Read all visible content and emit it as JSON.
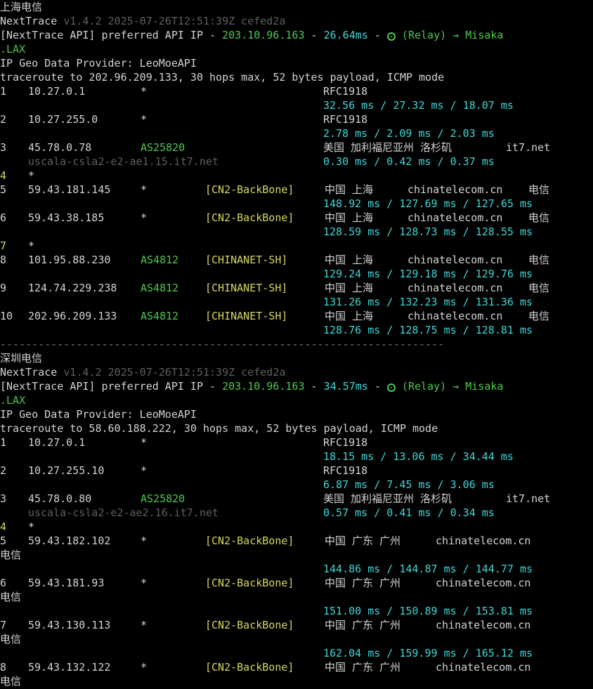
{
  "sections": [
    {
      "heading": "上海电信",
      "nt_name": "NextTrace",
      "nt_version": "v1.4.2 2025-07-26T12:51:39Z cefed2a",
      "api_prefix": "[NextTrace API] preferred API IP - ",
      "api_ip": "203.10.96.163",
      "api_dash1": " - ",
      "api_latency": "26.64ms",
      "api_dash2": " - ",
      "api_relay": "(Relay) → Misaka",
      "api_relay_cont": ".LAX",
      "geo_provider": "IP Geo Data Provider: LeoMoeAPI",
      "traceroute": "traceroute to 202.96.209.133, 30 hops max, 52 bytes payload, ICMP mode",
      "hops": [
        {
          "n": "1",
          "ip": "10.27.0.1",
          "asn": "*",
          "tag": "",
          "geo": "RFC1918",
          "domain": "",
          "isp": "",
          "host": "",
          "rtt": "32.56 ms / 27.32 ms / 18.07 ms"
        },
        {
          "n": "2",
          "ip": "10.27.255.0",
          "asn": "*",
          "tag": "",
          "geo": "RFC1918",
          "domain": "",
          "isp": "",
          "host": "",
          "rtt": "2.78 ms / 2.09 ms / 2.03 ms"
        },
        {
          "n": "3",
          "ip": "45.78.0.78",
          "asn": "AS25820",
          "tag": "",
          "geo": "美国 加利福尼亚州 洛杉矶",
          "domain": "it7.net",
          "isp": "",
          "host": "uscala-csla2-e2-ae1.15.it7.net",
          "rtt": "0.30 ms / 0.42 ms / 0.37 ms"
        },
        {
          "n": "4",
          "ip": "*",
          "asn": "",
          "tag": "",
          "geo": "",
          "domain": "",
          "isp": "",
          "host": "",
          "rtt": ""
        },
        {
          "n": "5",
          "ip": "59.43.181.145",
          "asn": "*",
          "tag": "[CN2-BackBone]",
          "geo": "中国 上海",
          "domain": "chinatelecom.cn",
          "isp": "电信",
          "host": "",
          "rtt": "148.92 ms / 127.69 ms / 127.65 ms"
        },
        {
          "n": "6",
          "ip": "59.43.38.185",
          "asn": "*",
          "tag": "[CN2-BackBone]",
          "geo": "中国 上海",
          "domain": "chinatelecom.cn",
          "isp": "电信",
          "host": "",
          "rtt": "128.59 ms / 128.73 ms / 128.55 ms"
        },
        {
          "n": "7",
          "ip": "*",
          "asn": "",
          "tag": "",
          "geo": "",
          "domain": "",
          "isp": "",
          "host": "",
          "rtt": ""
        },
        {
          "n": "8",
          "ip": "101.95.88.230",
          "asn": "AS4812",
          "tag": "[CHINANET-SH]",
          "geo": "中国 上海",
          "domain": "chinatelecom.cn",
          "isp": "电信",
          "host": "",
          "rtt": "129.24 ms / 129.18 ms / 129.76 ms"
        },
        {
          "n": "9",
          "ip": "124.74.229.238",
          "asn": "AS4812",
          "tag": "[CHINANET-SH]",
          "geo": "中国 上海",
          "domain": "chinatelecom.cn",
          "isp": "电信",
          "host": "",
          "rtt": "131.26 ms / 132.23 ms / 131.36 ms"
        },
        {
          "n": "10",
          "ip": "202.96.209.133",
          "asn": "AS4812",
          "tag": "[CHINANET-SH]",
          "geo": "中国 上海",
          "domain": "chinatelecom.cn",
          "isp": "电信",
          "host": "",
          "rtt": "128.76 ms / 128.75 ms / 128.81 ms"
        }
      ]
    },
    {
      "heading": "深圳电信",
      "nt_name": "NextTrace",
      "nt_version": "v1.4.2 2025-07-26T12:51:39Z cefed2a",
      "api_prefix": "[NextTrace API] preferred API IP - ",
      "api_ip": "203.10.96.163",
      "api_dash1": " - ",
      "api_latency": "34.57ms",
      "api_dash2": " - ",
      "api_relay": "(Relay) → Misaka",
      "api_relay_cont": ".LAX",
      "geo_provider": "IP Geo Data Provider: LeoMoeAPI",
      "traceroute": "traceroute to 58.60.188.222, 30 hops max, 52 bytes payload, ICMP mode",
      "hops": [
        {
          "n": "1",
          "ip": "10.27.0.1",
          "asn": "*",
          "tag": "",
          "geo": "RFC1918",
          "domain": "",
          "isp": "",
          "host": "",
          "rtt": "18.15 ms / 13.06 ms / 34.44 ms"
        },
        {
          "n": "2",
          "ip": "10.27.255.10",
          "asn": "*",
          "tag": "",
          "geo": "RFC1918",
          "domain": "",
          "isp": "",
          "host": "",
          "rtt": "6.87 ms / 7.45 ms / 3.06 ms"
        },
        {
          "n": "3",
          "ip": "45.78.0.80",
          "asn": "AS25820",
          "tag": "",
          "geo": "美国 加利福尼亚州 洛杉矶",
          "domain": "it7.net",
          "isp": "",
          "host": "uscala-csla2-e2-ae2.16.it7.net",
          "rtt": "0.57 ms / 0.41 ms / 0.34 ms"
        },
        {
          "n": "4",
          "ip": "*",
          "asn": "",
          "tag": "",
          "geo": "",
          "domain": "",
          "isp": "",
          "host": "",
          "rtt": ""
        },
        {
          "n": "5",
          "ip": "59.43.182.102",
          "asn": "*",
          "tag": "[CN2-BackBone]",
          "geo": "中国 广东 广州",
          "domain": "chinatelecom.cn",
          "isp": "电信",
          "host": "",
          "rtt": "144.86 ms / 144.87 ms / 144.77 ms"
        },
        {
          "n": "6",
          "ip": "59.43.181.93",
          "asn": "*",
          "tag": "[CN2-BackBone]",
          "geo": "中国 广东 广州",
          "domain": "chinatelecom.cn",
          "isp": "电信",
          "host": "",
          "rtt": "151.00 ms / 150.89 ms / 153.81 ms"
        },
        {
          "n": "7",
          "ip": "59.43.130.113",
          "asn": "*",
          "tag": "[CN2-BackBone]",
          "geo": "中国 广东 广州",
          "domain": "chinatelecom.cn",
          "isp": "电信",
          "host": "",
          "rtt": "162.04 ms / 159.99 ms / 165.12 ms"
        },
        {
          "n": "8",
          "ip": "59.43.132.122",
          "asn": "*",
          "tag": "[CN2-BackBone]",
          "geo": "中国 广东 广州",
          "domain": "chinatelecom.cn",
          "isp": "电信",
          "host": "",
          "rtt": ""
        }
      ]
    }
  ],
  "separator": "----------------------------------------------------------------------"
}
